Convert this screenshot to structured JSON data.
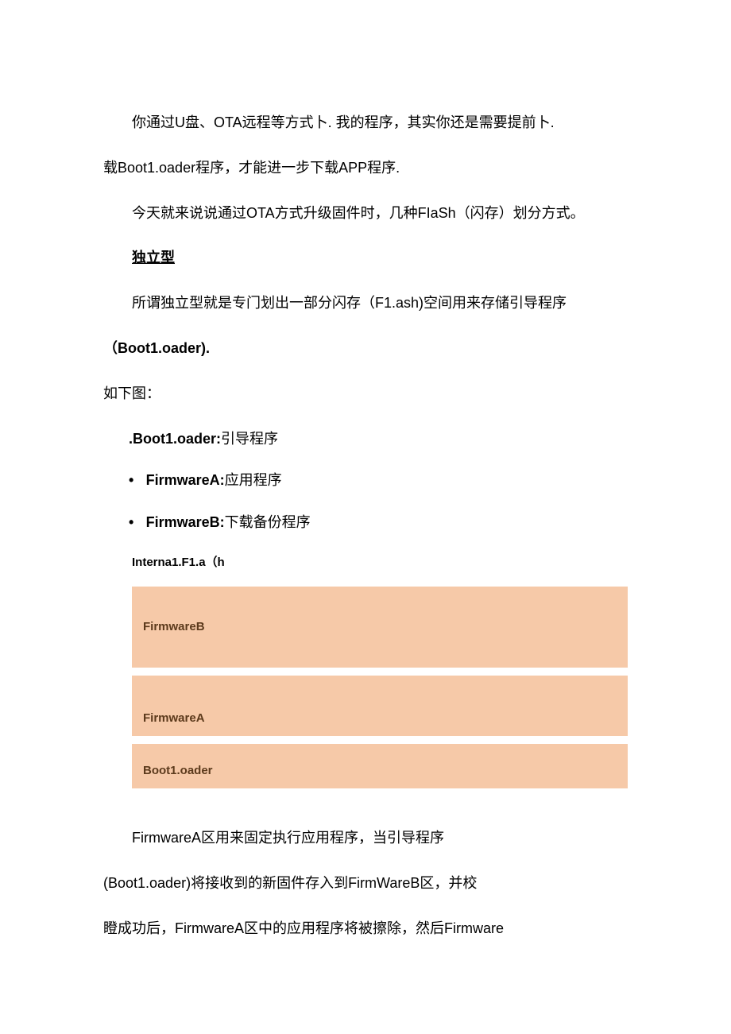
{
  "paragraph1_line1": "你通过U盘、OTA远程等方式卜. 我的程序，其实你还是需要提前卜.",
  "paragraph1_line2": "载Boot1.oader程序，才能进一步下载APP程序.",
  "paragraph2": "今天就来说说通过OTA方式升级固件时，几种FIaSh（闪存）划分方式。",
  "heading1": "独立型",
  "paragraph3_line1": "所谓独立型就是专门划出一部分闪存（F1.ash)空间用来存储引导程序",
  "paragraph3_line2": "（Boot1.oader).",
  "paragraph4": "如下图：",
  "list": {
    "item1_bold": ".Boot1.oader:",
    "item1_rest": "引导程序",
    "item2_bold": "FirmwareA:",
    "item2_rest": "应用程序",
    "item3_bold": "FirmwareB:",
    "item3_rest": "下载备份程序"
  },
  "diagram": {
    "header": "Interna1.F1.a（h",
    "bar1": "FirmwareB",
    "bar2": "FirmwareA",
    "bar3": "Boot1.oader"
  },
  "paragraph5_line1": "FirmwareA区用来固定执行应用程序，当引导程序",
  "paragraph5_line2": "(Boot1.oader)将接收到的新固件存入到FirmWareB区，并校",
  "paragraph5_line3": "瞪成功后，FirmwareA区中的应用程序将被擦除，然后Firmware"
}
